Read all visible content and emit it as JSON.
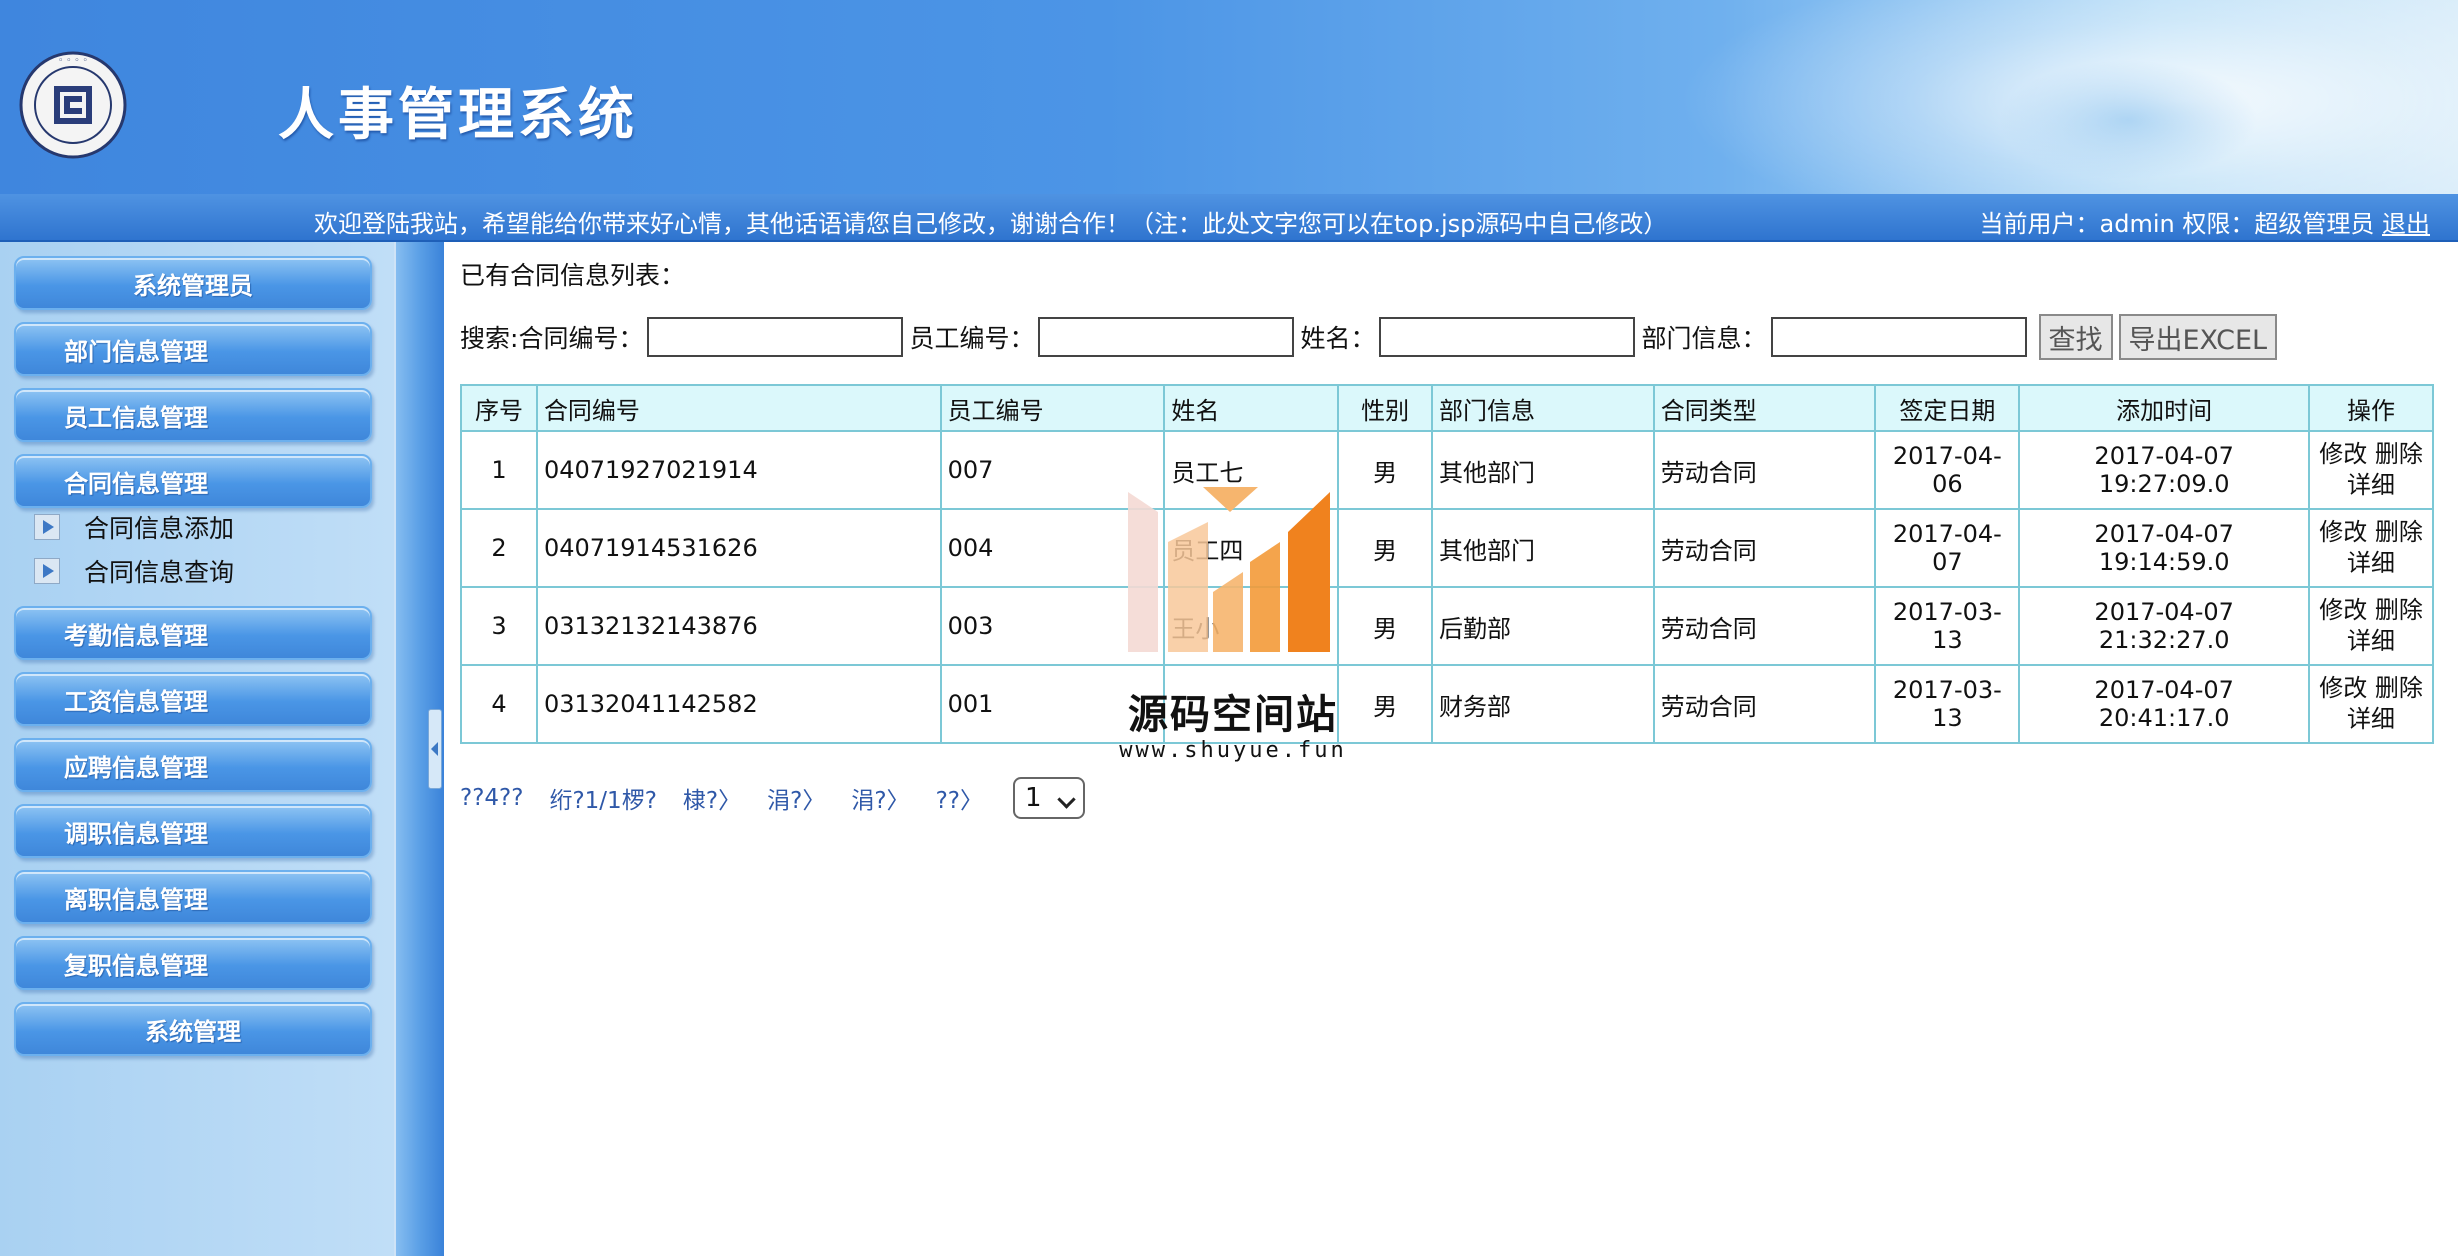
{
  "header": {
    "title": "人事管理系统",
    "welcome": "欢迎登陆我站，希望能给你带来好心情，其他话语请您自己修改，谢谢合作！（注：此处文字您可以在top.jsp源码中自己修改）",
    "user_prefix": "当前用户：admin 权限：超级管理员",
    "logout": "退出",
    "logo_icon": "university-seal-icon"
  },
  "sidebar": {
    "items": [
      {
        "label": "系统管理员"
      },
      {
        "label": "部门信息管理"
      },
      {
        "label": "员工信息管理"
      },
      {
        "label": "合同信息管理"
      },
      {
        "label": "考勤信息管理"
      },
      {
        "label": "工资信息管理"
      },
      {
        "label": "应聘信息管理"
      },
      {
        "label": "调职信息管理"
      },
      {
        "label": "离职信息管理"
      },
      {
        "label": "复职信息管理"
      },
      {
        "label": "系统管理"
      }
    ],
    "sub_items": [
      {
        "label": "合同信息添加"
      },
      {
        "label": "合同信息查询"
      }
    ]
  },
  "main": {
    "list_title": "已有合同信息列表：",
    "search": {
      "prefix": "搜索: ",
      "contract_no_label": "合同编号：",
      "contract_no_value": "",
      "emp_no_label": "员工编号：",
      "emp_no_value": "",
      "name_label": "姓名：",
      "name_value": "",
      "dept_label": "部门信息：",
      "dept_value": "",
      "find_button": "查找",
      "export_button": "导出EXCEL"
    },
    "table": {
      "headers": [
        "序号",
        "合同编号",
        "员工编号",
        "姓名",
        "性别",
        "部门信息",
        "合同类型",
        "签定日期",
        "添加时间",
        "操作"
      ],
      "rows": [
        {
          "idx": "1",
          "contract_no": "04071927021914",
          "emp_no": "007",
          "name": "员工七",
          "gender": "男",
          "dept": "其他部门",
          "type": "劳动合同",
          "sign_date": "2017-04-06",
          "add_time": "2017-04-07 19:27:09.0"
        },
        {
          "idx": "2",
          "contract_no": "04071914531626",
          "emp_no": "004",
          "name": "员工四",
          "gender": "男",
          "dept": "其他部门",
          "type": "劳动合同",
          "sign_date": "2017-04-07",
          "add_time": "2017-04-07 19:14:59.0"
        },
        {
          "idx": "3",
          "contract_no": "03132132143876",
          "emp_no": "003",
          "name": "王小",
          "gender": "男",
          "dept": "后勤部",
          "type": "劳动合同",
          "sign_date": "2017-03-13",
          "add_time": "2017-04-07 21:32:27.0"
        },
        {
          "idx": "4",
          "contract_no": "03132041142582",
          "emp_no": "001",
          "name": "",
          "gender": "男",
          "dept": "财务部",
          "type": "劳动合同",
          "sign_date": "2017-03-13",
          "add_time": "2017-04-07 20:41:17.0"
        }
      ],
      "op_edit": "修改",
      "op_delete": "删除",
      "op_detail": "详细"
    },
    "pager": {
      "links": [
        "??4??",
        "绗?1/1椤?",
        "棣?〉",
        "涓?〉",
        "涓?〉",
        "??〉"
      ],
      "page_select": "1"
    }
  },
  "watermark": {
    "text": "源码空间站",
    "url": "www.shuyue.fun"
  },
  "colors": {
    "header_blue": "#3f86de",
    "table_border": "#7cc8d6",
    "table_header_bg": "#dbf8fb",
    "sidebar_bg": "#b5d8f5",
    "watermark_orange": "#f0821e"
  }
}
